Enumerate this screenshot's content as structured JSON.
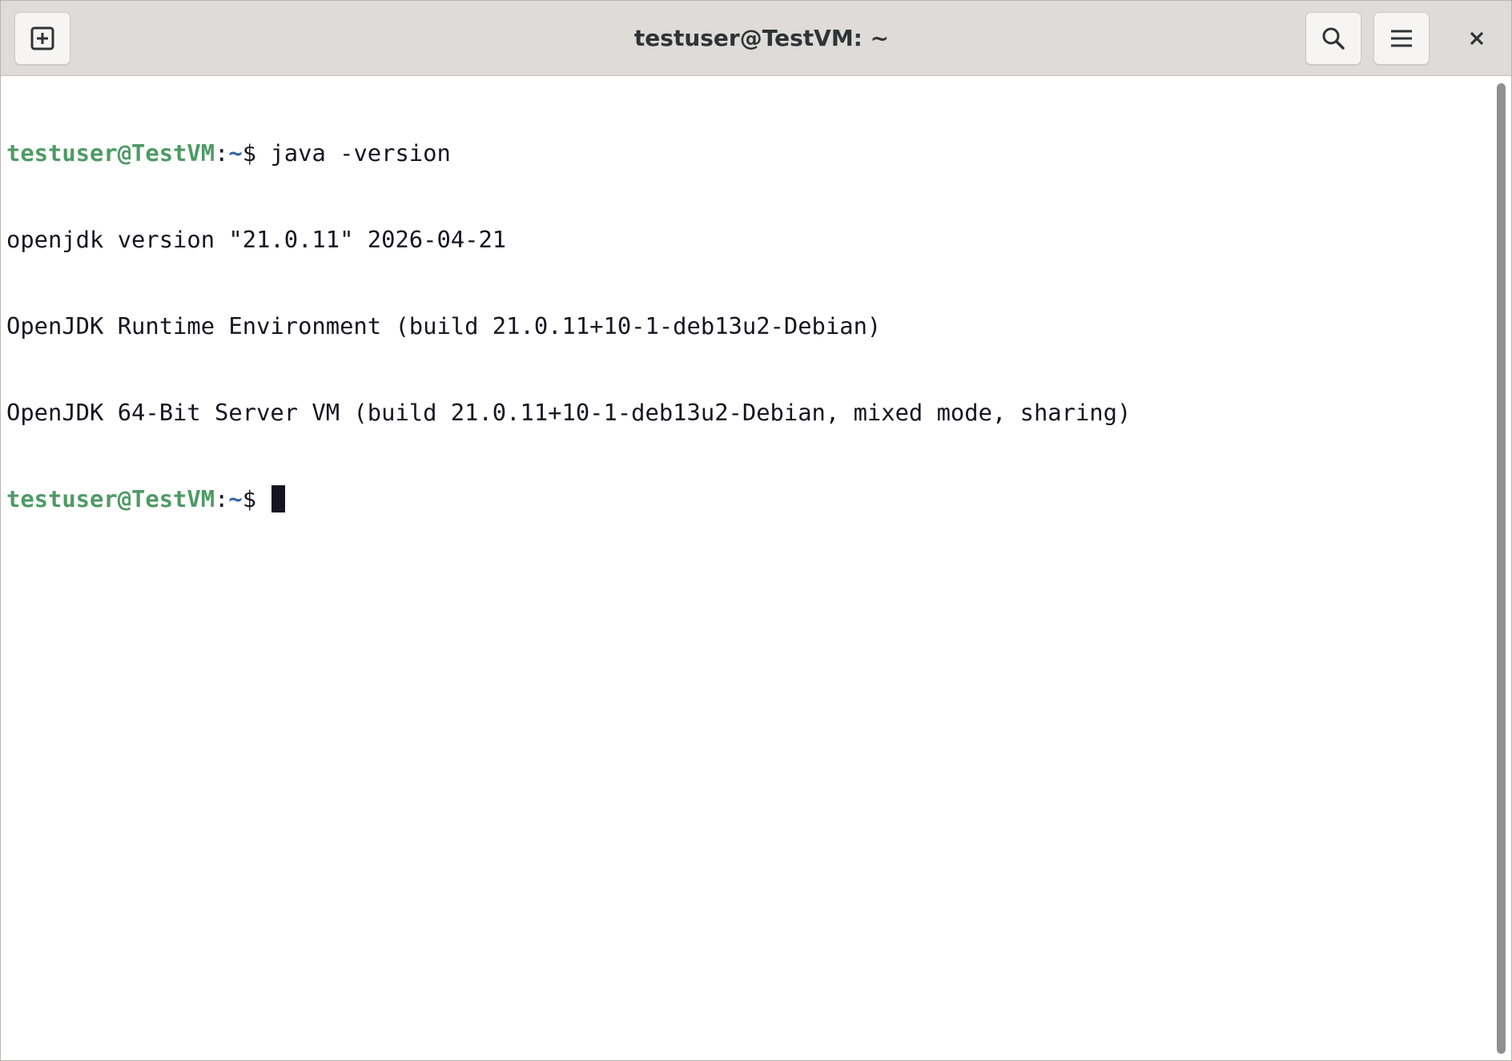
{
  "window": {
    "title": "testuser@TestVM: ~"
  },
  "headerbar": {
    "new_tab_icon": "new-tab-icon",
    "search_icon": "search-icon",
    "menu_icon": "hamburger-menu-icon",
    "close_icon": "close-icon"
  },
  "terminal": {
    "lines": [
      {
        "user": "testuser@TestVM",
        "colon": ":",
        "path": "~",
        "sign": "$ ",
        "command": "java -version"
      },
      {
        "text": "openjdk version \"21.0.11\" 2026-04-21"
      },
      {
        "text": "OpenJDK Runtime Environment (build 21.0.11+10-1-deb13u2-Debian)"
      },
      {
        "text": "OpenJDK 64-Bit Server VM (build 21.0.11+10-1-deb13u2-Debian, mixed mode, sharing)"
      },
      {
        "user": "testuser@TestVM",
        "colon": ":",
        "path": "~",
        "sign": "$ ",
        "command": ""
      }
    ]
  },
  "colors": {
    "prompt_user": "#4e9a65",
    "prompt_path": "#3465a4",
    "text": "#171421",
    "headerbar_bg": "#dedbd8"
  }
}
